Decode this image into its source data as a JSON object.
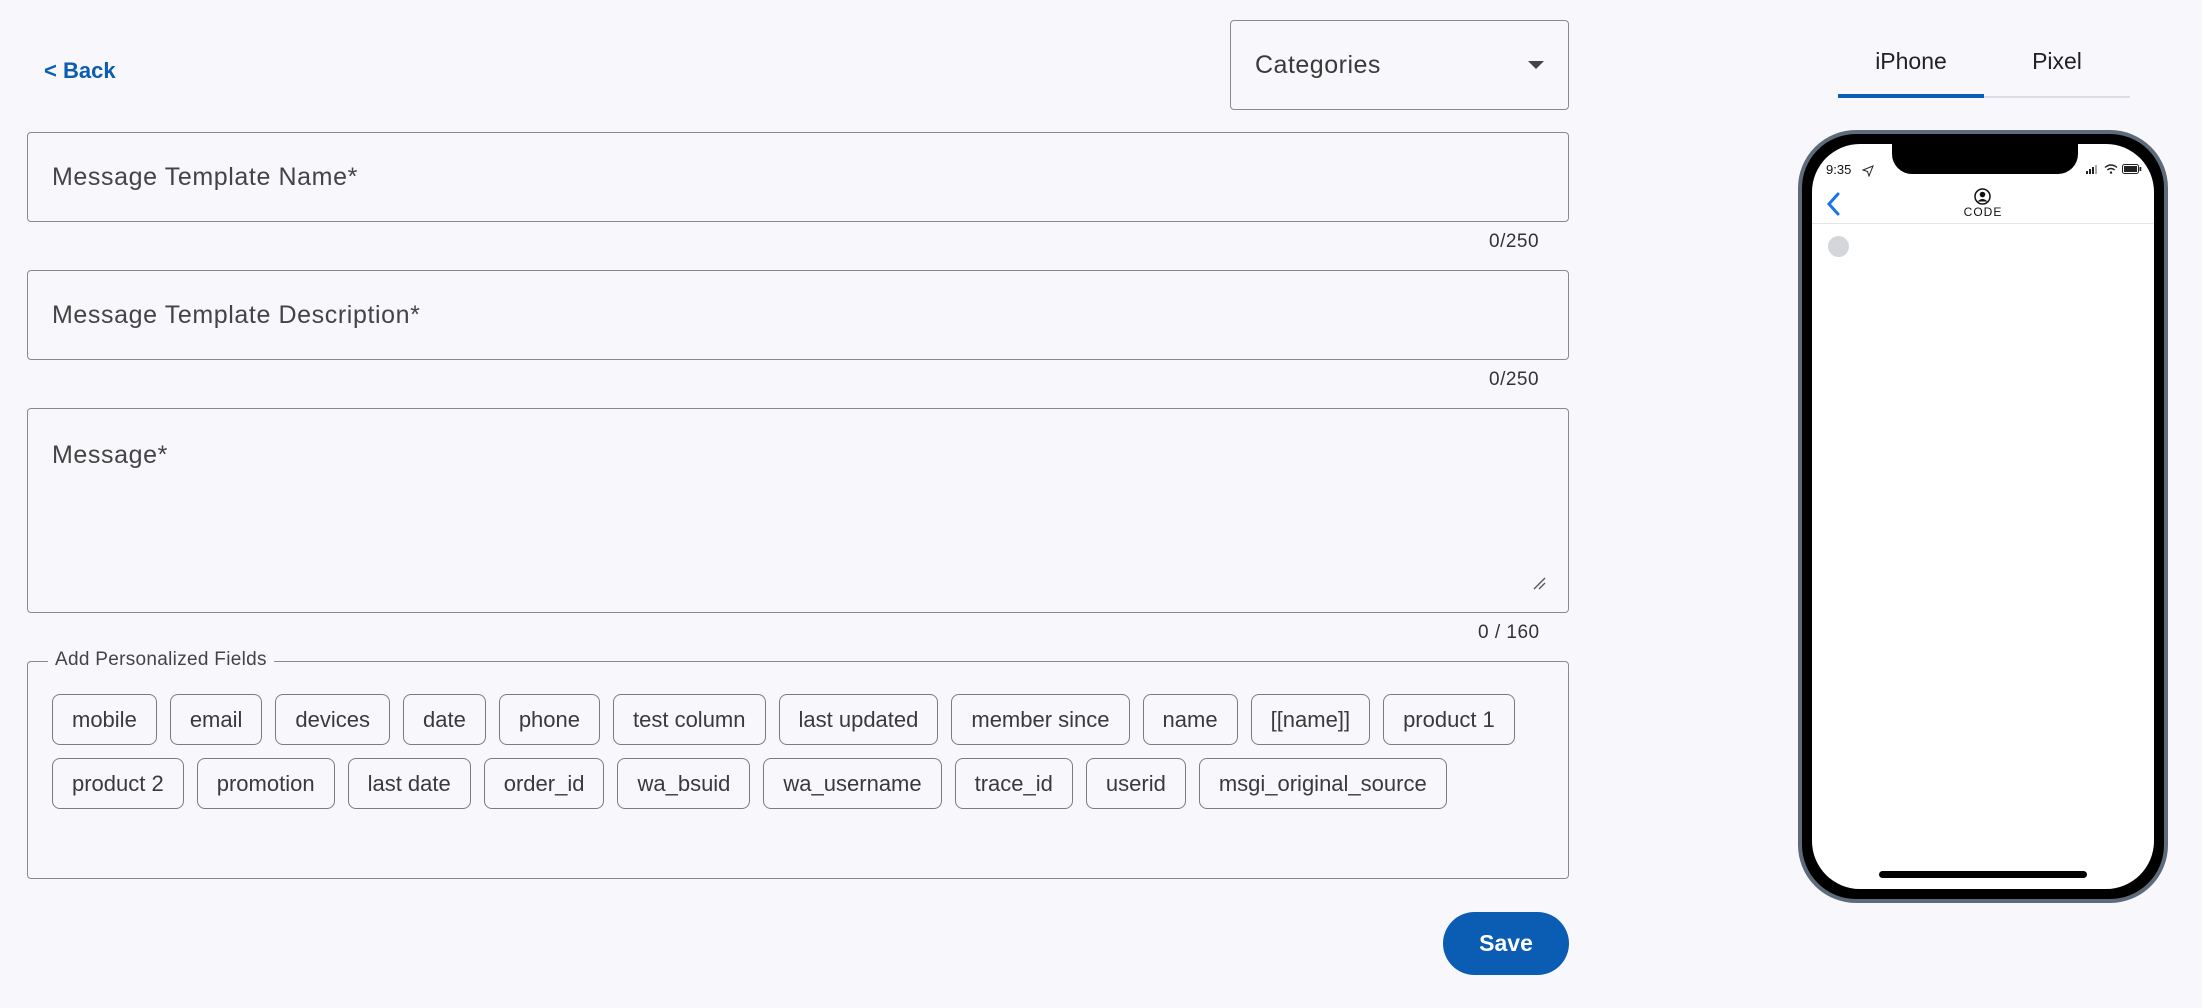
{
  "header": {
    "back_label": "< Back",
    "categories_label": "Categories"
  },
  "form": {
    "name_placeholder": "Message Template Name*",
    "name_counter": "0/250",
    "description_placeholder": "Message Template Description*",
    "description_counter": "0/250",
    "message_placeholder": "Message*",
    "message_counter": "0 / 160"
  },
  "personalized": {
    "legend": "Add Personalized Fields",
    "chips": [
      "mobile",
      "email",
      "devices",
      "date",
      "phone",
      "test column",
      "last updated",
      "member since",
      "name",
      "[[name]]",
      "product 1",
      "product 2",
      "promotion",
      "last date",
      "order_id",
      "wa_bsuid",
      "wa_username",
      "trace_id",
      "userid",
      "msgi_original_source"
    ]
  },
  "actions": {
    "save_label": "Save"
  },
  "preview": {
    "tabs": [
      "iPhone",
      "Pixel"
    ],
    "active_tab": "iPhone",
    "status_time": "9:35",
    "app_title": "CODE"
  },
  "colors": {
    "accent": "#0b5cb3",
    "background": "#f8f8fc",
    "border": "#8a8a8a"
  }
}
